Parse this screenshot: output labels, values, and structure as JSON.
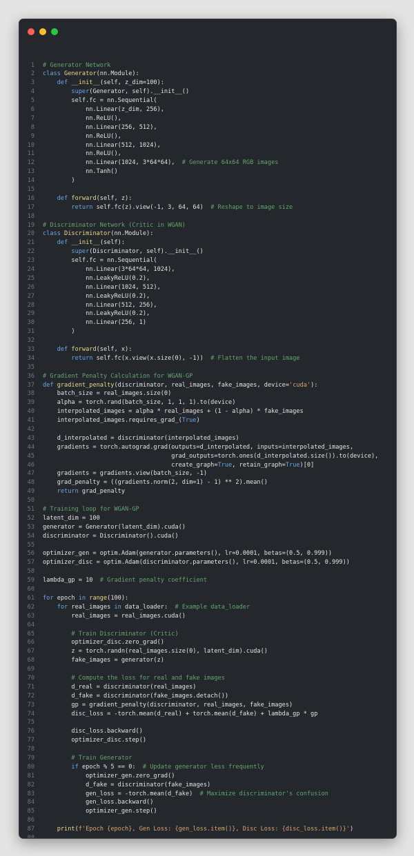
{
  "window": {
    "controls": [
      {
        "name": "close",
        "color": "#ff5f56"
      },
      {
        "name": "minimize",
        "color": "#ffbd2e"
      },
      {
        "name": "maximize",
        "color": "#27c93f"
      }
    ]
  },
  "colors": {
    "background": "#24272b",
    "keyword": "#6aa6e8",
    "function": "#e6d98a",
    "comment": "#62a66f",
    "string": "#d8a56e",
    "text": "#e3e3e3"
  },
  "code": {
    "lines": [
      {
        "n": "1",
        "t": [
          [
            "c",
            "# Generator Network"
          ]
        ]
      },
      {
        "n": "2",
        "t": [
          [
            "k",
            "class "
          ],
          [
            "f",
            "Generator"
          ],
          [
            "t",
            "(nn.Module):"
          ]
        ]
      },
      {
        "n": "3",
        "t": [
          [
            "t",
            "    "
          ],
          [
            "k",
            "def "
          ],
          [
            "f",
            "__init__"
          ],
          [
            "t",
            "(self, z_dim=100):"
          ]
        ]
      },
      {
        "n": "4",
        "t": [
          [
            "t",
            "        "
          ],
          [
            "k",
            "super"
          ],
          [
            "t",
            "(Generator, self).__init__()"
          ]
        ]
      },
      {
        "n": "5",
        "t": [
          [
            "t",
            "        self.fc = nn.Sequential("
          ]
        ]
      },
      {
        "n": "6",
        "t": [
          [
            "t",
            "            nn.Linear(z_dim, 256),"
          ]
        ]
      },
      {
        "n": "7",
        "t": [
          [
            "t",
            "            nn.ReLU(),"
          ]
        ]
      },
      {
        "n": "8",
        "t": [
          [
            "t",
            "            nn.Linear(256, 512),"
          ]
        ]
      },
      {
        "n": "9",
        "t": [
          [
            "t",
            "            nn.ReLU(),"
          ]
        ]
      },
      {
        "n": "10",
        "t": [
          [
            "t",
            "            nn.Linear(512, 1024),"
          ]
        ]
      },
      {
        "n": "11",
        "t": [
          [
            "t",
            "            nn.ReLU(),"
          ]
        ]
      },
      {
        "n": "12",
        "t": [
          [
            "t",
            "            nn.Linear(1024, 3*64*64),  "
          ],
          [
            "c",
            "# Generate 64x64 RGB images"
          ]
        ]
      },
      {
        "n": "13",
        "t": [
          [
            "t",
            "            nn.Tanh()"
          ]
        ]
      },
      {
        "n": "14",
        "t": [
          [
            "t",
            "        )"
          ]
        ]
      },
      {
        "n": "15",
        "t": [
          [
            "t",
            ""
          ]
        ]
      },
      {
        "n": "16",
        "t": [
          [
            "t",
            "    "
          ],
          [
            "k",
            "def "
          ],
          [
            "f",
            "forward"
          ],
          [
            "t",
            "(self, z):"
          ]
        ]
      },
      {
        "n": "17",
        "t": [
          [
            "t",
            "        "
          ],
          [
            "k",
            "return "
          ],
          [
            "t",
            "self.fc(z).view(-1, 3, 64, 64)  "
          ],
          [
            "c",
            "# Reshape to image size"
          ]
        ]
      },
      {
        "n": "18",
        "t": [
          [
            "t",
            ""
          ]
        ]
      },
      {
        "n": "19",
        "t": [
          [
            "c",
            "# Discriminator Network (Critic in WGAN)"
          ]
        ]
      },
      {
        "n": "20",
        "t": [
          [
            "k",
            "class "
          ],
          [
            "f",
            "Discriminator"
          ],
          [
            "t",
            "(nn.Module):"
          ]
        ]
      },
      {
        "n": "21",
        "t": [
          [
            "t",
            "    "
          ],
          [
            "k",
            "def "
          ],
          [
            "f",
            "__init__"
          ],
          [
            "t",
            "(self):"
          ]
        ]
      },
      {
        "n": "22",
        "t": [
          [
            "t",
            "        "
          ],
          [
            "k",
            "super"
          ],
          [
            "t",
            "(Discriminator, self).__init__()"
          ]
        ]
      },
      {
        "n": "23",
        "t": [
          [
            "t",
            "        self.fc = nn.Sequential("
          ]
        ]
      },
      {
        "n": "24",
        "t": [
          [
            "t",
            "            nn.Linear(3*64*64, 1024),"
          ]
        ]
      },
      {
        "n": "25",
        "t": [
          [
            "t",
            "            nn.LeakyReLU(0.2),"
          ]
        ]
      },
      {
        "n": "26",
        "t": [
          [
            "t",
            "            nn.Linear(1024, 512),"
          ]
        ]
      },
      {
        "n": "27",
        "t": [
          [
            "t",
            "            nn.LeakyReLU(0.2),"
          ]
        ]
      },
      {
        "n": "28",
        "t": [
          [
            "t",
            "            nn.Linear(512, 256),"
          ]
        ]
      },
      {
        "n": "29",
        "t": [
          [
            "t",
            "            nn.LeakyReLU(0.2),"
          ]
        ]
      },
      {
        "n": "30",
        "t": [
          [
            "t",
            "            nn.Linear(256, 1)"
          ]
        ]
      },
      {
        "n": "31",
        "t": [
          [
            "t",
            "        )"
          ]
        ]
      },
      {
        "n": "32",
        "t": [
          [
            "t",
            ""
          ]
        ]
      },
      {
        "n": "33",
        "t": [
          [
            "t",
            "    "
          ],
          [
            "k",
            "def "
          ],
          [
            "f",
            "forward"
          ],
          [
            "t",
            "(self, x):"
          ]
        ]
      },
      {
        "n": "34",
        "t": [
          [
            "t",
            "        "
          ],
          [
            "k",
            "return "
          ],
          [
            "t",
            "self.fc(x.view(x.size(0), -1))  "
          ],
          [
            "c",
            "# Flatten the input image"
          ]
        ]
      },
      {
        "n": "35",
        "t": [
          [
            "t",
            ""
          ]
        ]
      },
      {
        "n": "36",
        "t": [
          [
            "c",
            "# Gradient Penalty Calculation for WGAN-GP"
          ]
        ]
      },
      {
        "n": "37",
        "t": [
          [
            "k",
            "def "
          ],
          [
            "f",
            "gradient_penalty"
          ],
          [
            "t",
            "(discriminator, real_images, fake_images, device="
          ],
          [
            "s",
            "'cuda'"
          ],
          [
            "t",
            "):"
          ]
        ]
      },
      {
        "n": "38",
        "t": [
          [
            "t",
            "    batch_size = real_images.size(0)"
          ]
        ]
      },
      {
        "n": "39",
        "t": [
          [
            "t",
            "    alpha = torch.rand(batch_size, 1, 1, 1).to(device)"
          ]
        ]
      },
      {
        "n": "40",
        "t": [
          [
            "t",
            "    interpolated_images = alpha * real_images + (1 - alpha) * fake_images"
          ]
        ]
      },
      {
        "n": "41",
        "t": [
          [
            "t",
            "    interpolated_images.requires_grad_("
          ],
          [
            "k",
            "True"
          ],
          [
            "t",
            ")"
          ]
        ]
      },
      {
        "n": "42",
        "t": [
          [
            "t",
            ""
          ]
        ]
      },
      {
        "n": "43",
        "t": [
          [
            "t",
            "    d_interpolated = discriminator(interpolated_images)"
          ]
        ]
      },
      {
        "n": "44",
        "t": [
          [
            "t",
            "    gradients = torch.autograd.grad(outputs=d_interpolated, inputs=interpolated_images,"
          ]
        ]
      },
      {
        "n": "45",
        "t": [
          [
            "t",
            "                                    grad_outputs=torch.ones(d_interpolated.size()).to(device),"
          ]
        ]
      },
      {
        "n": "46",
        "t": [
          [
            "t",
            "                                    create_graph="
          ],
          [
            "k",
            "True"
          ],
          [
            "t",
            ", retain_graph="
          ],
          [
            "k",
            "True"
          ],
          [
            "t",
            ")[0]"
          ]
        ]
      },
      {
        "n": "47",
        "t": [
          [
            "t",
            "    gradients = gradients.view(batch_size, -1)"
          ]
        ]
      },
      {
        "n": "48",
        "t": [
          [
            "t",
            "    grad_penalty = ((gradients.norm(2, dim=1) - 1) ** 2).mean()"
          ]
        ]
      },
      {
        "n": "49",
        "t": [
          [
            "t",
            "    "
          ],
          [
            "k",
            "return "
          ],
          [
            "t",
            "grad_penalty"
          ]
        ]
      },
      {
        "n": "50",
        "t": [
          [
            "t",
            ""
          ]
        ]
      },
      {
        "n": "51",
        "t": [
          [
            "c",
            "# Training loop for WGAN-GP"
          ]
        ]
      },
      {
        "n": "52",
        "t": [
          [
            "t",
            "latent_dim = 100"
          ]
        ]
      },
      {
        "n": "53",
        "t": [
          [
            "t",
            "generator = Generator(latent_dim).cuda()"
          ]
        ]
      },
      {
        "n": "54",
        "t": [
          [
            "t",
            "discriminator = Discriminator().cuda()"
          ]
        ]
      },
      {
        "n": "55",
        "t": [
          [
            "t",
            ""
          ]
        ]
      },
      {
        "n": "56",
        "t": [
          [
            "t",
            "optimizer_gen = optim.Adam(generator.parameters(), lr=0.0001, betas=(0.5, 0.999))"
          ]
        ]
      },
      {
        "n": "57",
        "t": [
          [
            "t",
            "optimizer_disc = optim.Adam(discriminator.parameters(), lr=0.0001, betas=(0.5, 0.999))"
          ]
        ]
      },
      {
        "n": "58",
        "t": [
          [
            "t",
            ""
          ]
        ]
      },
      {
        "n": "59",
        "t": [
          [
            "t",
            "lambda_gp = 10  "
          ],
          [
            "c",
            "# Gradient penalty coefficient"
          ]
        ]
      },
      {
        "n": "60",
        "t": [
          [
            "t",
            ""
          ]
        ]
      },
      {
        "n": "61",
        "t": [
          [
            "k",
            "for "
          ],
          [
            "t",
            "epoch "
          ],
          [
            "k",
            "in "
          ],
          [
            "f",
            "range"
          ],
          [
            "t",
            "(100):"
          ]
        ]
      },
      {
        "n": "62",
        "t": [
          [
            "t",
            "    "
          ],
          [
            "k",
            "for "
          ],
          [
            "t",
            "real_images "
          ],
          [
            "k",
            "in "
          ],
          [
            "t",
            "data_loader:  "
          ],
          [
            "c",
            "# Example data_loader"
          ]
        ]
      },
      {
        "n": "63",
        "t": [
          [
            "t",
            "        real_images = real_images.cuda()"
          ]
        ]
      },
      {
        "n": "64",
        "t": [
          [
            "t",
            ""
          ]
        ]
      },
      {
        "n": "65",
        "t": [
          [
            "t",
            "        "
          ],
          [
            "c",
            "# Train Discriminator (Critic)"
          ]
        ]
      },
      {
        "n": "66",
        "t": [
          [
            "t",
            "        optimizer_disc.zero_grad()"
          ]
        ]
      },
      {
        "n": "67",
        "t": [
          [
            "t",
            "        z = torch.randn(real_images.size(0), latent_dim).cuda()"
          ]
        ]
      },
      {
        "n": "68",
        "t": [
          [
            "t",
            "        fake_images = generator(z)"
          ]
        ]
      },
      {
        "n": "69",
        "t": [
          [
            "t",
            ""
          ]
        ]
      },
      {
        "n": "70",
        "t": [
          [
            "t",
            "        "
          ],
          [
            "c",
            "# Compute the loss for real and fake images"
          ]
        ]
      },
      {
        "n": "71",
        "t": [
          [
            "t",
            "        d_real = discriminator(real_images)"
          ]
        ]
      },
      {
        "n": "72",
        "t": [
          [
            "t",
            "        d_fake = discriminator(fake_images.detach())"
          ]
        ]
      },
      {
        "n": "73",
        "t": [
          [
            "t",
            "        gp = gradient_penalty(discriminator, real_images, fake_images)"
          ]
        ]
      },
      {
        "n": "74",
        "t": [
          [
            "t",
            "        disc_loss = -torch.mean(d_real) + torch.mean(d_fake) + lambda_gp * gp"
          ]
        ]
      },
      {
        "n": "75",
        "t": [
          [
            "t",
            ""
          ]
        ]
      },
      {
        "n": "76",
        "t": [
          [
            "t",
            "        disc_loss.backward()"
          ]
        ]
      },
      {
        "n": "77",
        "t": [
          [
            "t",
            "        optimizer_disc.step()"
          ]
        ]
      },
      {
        "n": "78",
        "t": [
          [
            "t",
            ""
          ]
        ]
      },
      {
        "n": "79",
        "t": [
          [
            "t",
            "        "
          ],
          [
            "c",
            "# Train Generator"
          ]
        ]
      },
      {
        "n": "80",
        "t": [
          [
            "t",
            "        "
          ],
          [
            "k",
            "if "
          ],
          [
            "t",
            "epoch % 5 == 0:  "
          ],
          [
            "c",
            "# Update generator less frequently"
          ]
        ]
      },
      {
        "n": "81",
        "t": [
          [
            "t",
            "            optimizer_gen.zero_grad()"
          ]
        ]
      },
      {
        "n": "82",
        "t": [
          [
            "t",
            "            d_fake = discriminator(fake_images)"
          ]
        ]
      },
      {
        "n": "83",
        "t": [
          [
            "t",
            "            gen_loss = -torch.mean(d_fake)  "
          ],
          [
            "c",
            "# Maximize discriminator's confusion"
          ]
        ]
      },
      {
        "n": "84",
        "t": [
          [
            "t",
            "            gen_loss.backward()"
          ]
        ]
      },
      {
        "n": "85",
        "t": [
          [
            "t",
            "            optimizer_gen.step()"
          ]
        ]
      },
      {
        "n": "86",
        "t": [
          [
            "t",
            ""
          ]
        ]
      },
      {
        "n": "87",
        "t": [
          [
            "t",
            "    "
          ],
          [
            "f",
            "print"
          ],
          [
            "t",
            "("
          ],
          [
            "s",
            "f'Epoch {epoch}, Gen Loss: {gen_loss.item()}, Disc Loss: {disc_loss.item()}'"
          ],
          [
            "t",
            ")"
          ]
        ]
      },
      {
        "n": "88",
        "t": [
          [
            "t",
            ""
          ]
        ]
      }
    ]
  }
}
